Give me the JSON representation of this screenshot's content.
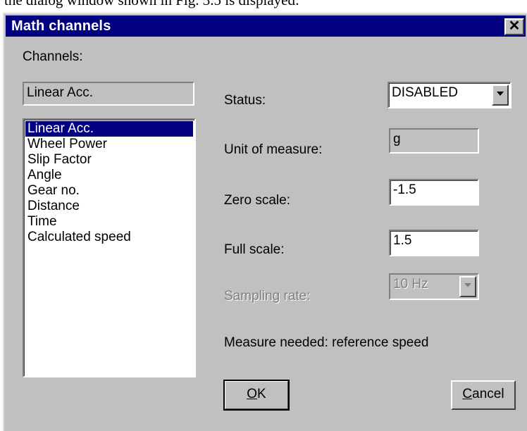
{
  "doc_text": "the dialog window shown in Fig. 3.5 is displayed:",
  "dialog": {
    "title": "Math channels",
    "close_glyph": "✕"
  },
  "channels": {
    "label": "Channels:",
    "current": "Linear Acc.",
    "items": [
      "Linear Acc.",
      "Wheel Power",
      "Slip Factor",
      "Angle",
      "Gear no.",
      "Distance",
      "Time",
      "Calculated speed"
    ],
    "selected_index": 0
  },
  "form": {
    "status_label": "Status:",
    "status_value": "DISABLED",
    "unit_label": "Unit of measure:",
    "unit_value": "g",
    "zero_label": "Zero scale:",
    "zero_value": "-1.5",
    "full_label": "Full scale:",
    "full_value": "1.5",
    "sampling_label": "Sampling rate:",
    "sampling_value": "10 Hz",
    "measure_needed": "Measure needed: reference speed"
  },
  "buttons": {
    "ok_accel": "O",
    "ok_rest": "K",
    "cancel_accel": "C",
    "cancel_rest": "ancel"
  },
  "colors": {
    "title_bar": "#000080",
    "dialog_face": "#c0c0c0",
    "selection": "#000080"
  },
  "icons": {
    "close": "close-icon",
    "dropdown": "chevron-down-icon"
  }
}
